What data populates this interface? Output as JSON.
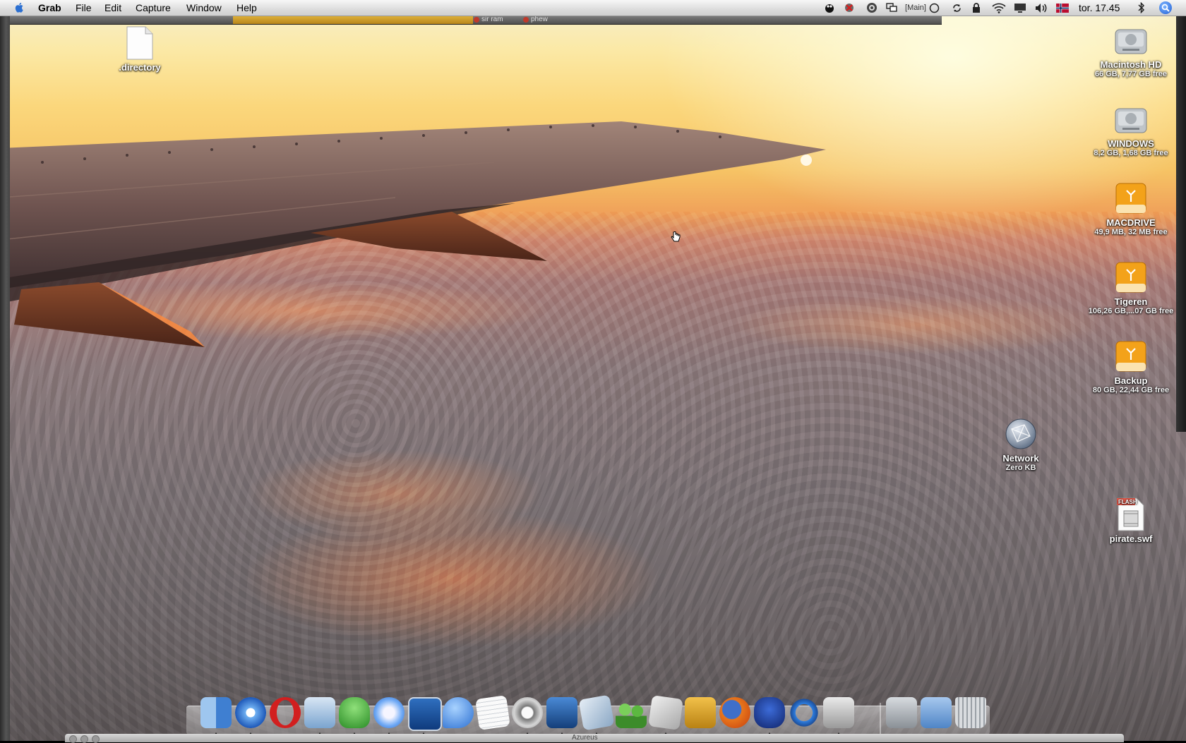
{
  "menubar": {
    "app_name": "Grab",
    "menus": [
      "File",
      "Edit",
      "Capture",
      "Window",
      "Help"
    ],
    "extras": {
      "spaces_label": "[Main]",
      "clock": "tor. 17.45"
    }
  },
  "top_strip": {
    "tabs": [
      "sir ram",
      "phew"
    ]
  },
  "desktop": {
    "file_directory": ".directory",
    "volumes": [
      {
        "name": "Macintosh HD",
        "info": "66 GB, 7,77 GB free"
      },
      {
        "name": "WINDOWS",
        "info": "8,2 GB, 1,68 GB free"
      },
      {
        "name": "MACDRIVE",
        "info": "49,9 MB, 32 MB free"
      },
      {
        "name": "Tigeren",
        "info": "106,26 GB,...07 GB free"
      },
      {
        "name": "Backup",
        "info": "80 GB, 22,44 GB free"
      }
    ],
    "network": {
      "name": "Network",
      "info": "Zero KB"
    },
    "flash_file": {
      "name": "pirate.swf",
      "badge": "FLASH"
    }
  },
  "dock": {
    "items": [
      "finder-icon",
      "safari-icon",
      "opera-icon",
      "mail-icon",
      "adium-icon",
      "itunes-icon",
      "dashboard-icon",
      "ichat-icon",
      "textedit-icon",
      "system-preferences-icon",
      "photo-booth-icon",
      "preview-icon",
      "people-icon",
      "script-editor-icon",
      "utilities-icon",
      "firefox-icon",
      "frog-icon",
      "quicktime-icon",
      "grab-icon",
      "hard-drive-icon",
      "applications-folder-icon",
      "trash-icon"
    ]
  },
  "bottom_window": {
    "title": "Azureus"
  },
  "colors": {
    "menubar_top": "#f7f7f7",
    "menubar_bottom": "#cfcfcf",
    "sky_top": "#f6efd0",
    "sunset": "#f0a25a",
    "clouds": "#6b6466",
    "drive_orange": "#f3a21a"
  }
}
